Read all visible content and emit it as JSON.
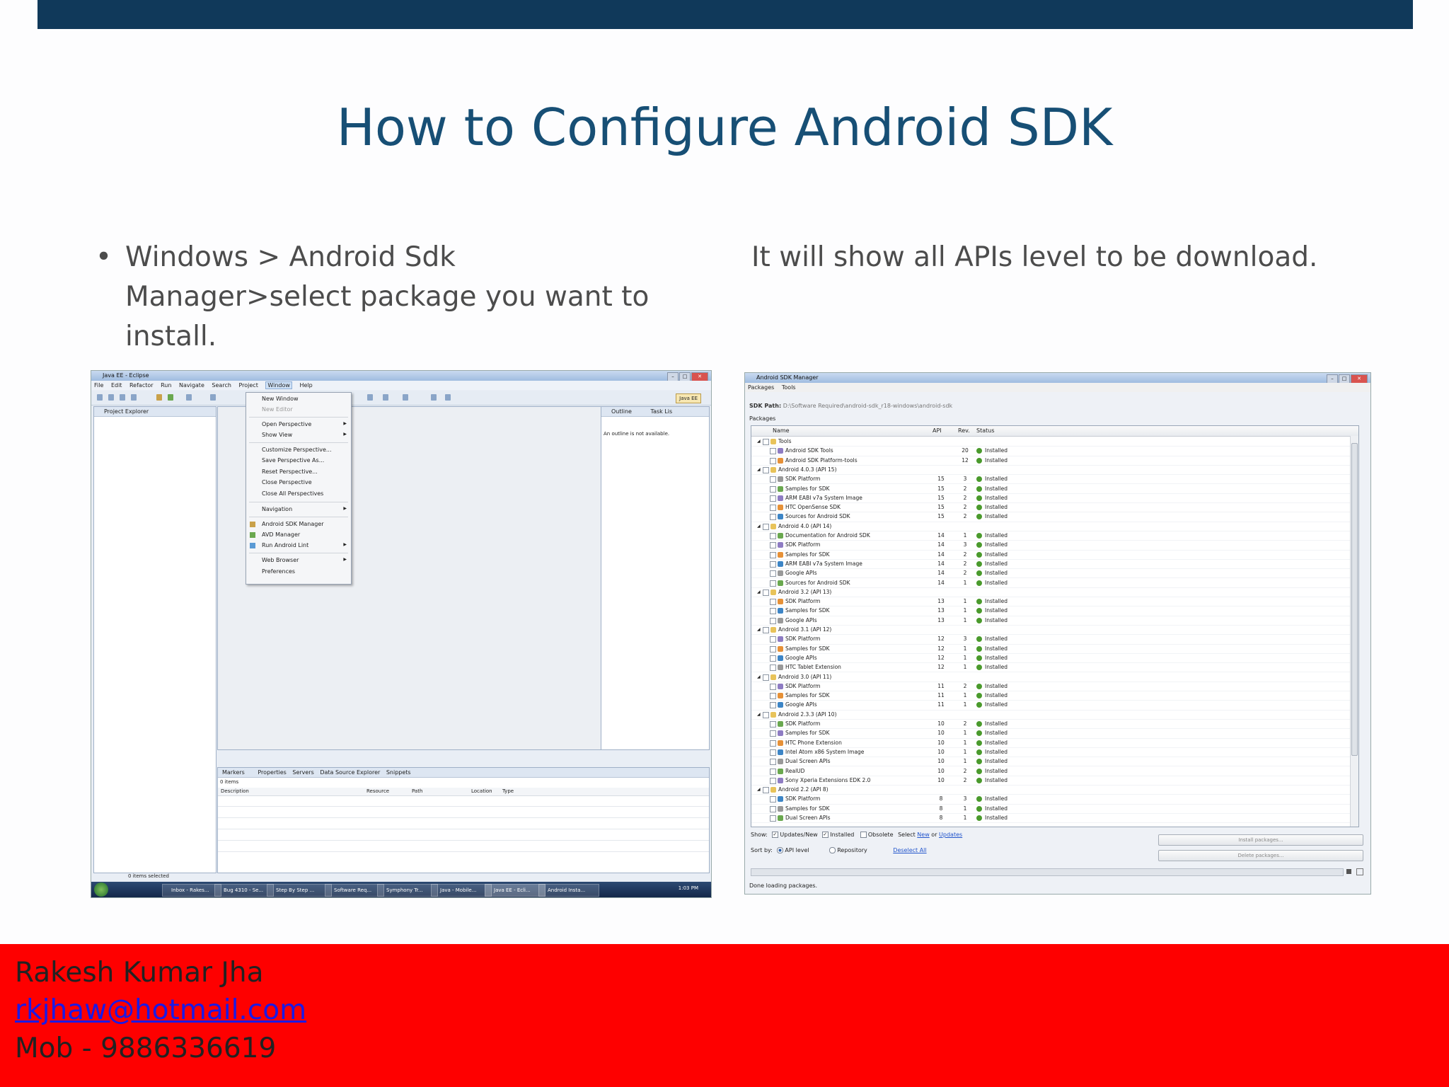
{
  "slide": {
    "title": "How to Configure Android SDK",
    "bullet_left": "Windows > Android Sdk Manager>select package you want to install.",
    "bullet_right": "It will show all APIs level to be download."
  },
  "footer": {
    "name": "Rakesh Kumar Jha",
    "email": "rkjhaw@hotmail.com",
    "phone": "Mob - 9886336619"
  },
  "colors": {
    "top_bar": "#10395a",
    "title": "#174f75",
    "footer_bg": "#fe0000",
    "link": "#1a1ae6"
  },
  "eclipse": {
    "window_title": "Java EE - Eclipse",
    "menus": [
      "File",
      "Edit",
      "Refactor",
      "Run",
      "Navigate",
      "Search",
      "Project",
      "Window",
      "Help"
    ],
    "active_menu": "Window",
    "perspective": "Java EE",
    "project_explorer_title": "Project Explorer",
    "outline_title": "Outline",
    "task_list_title": "Task Lis",
    "outline_message": "An outline is not available.",
    "window_menu_items": [
      "New Window",
      "New Editor",
      "Open Perspective",
      "Show View",
      "Customize Perspective...",
      "Save Perspective As...",
      "Reset Perspective...",
      "Close Perspective",
      "Close All Perspectives",
      "Navigation",
      "Android SDK Manager",
      "AVD Manager",
      "Run Android Lint",
      "Web Browser",
      "Preferences"
    ],
    "bottom_tabs": [
      "Markers",
      "Properties",
      "Servers",
      "Data Source Explorer",
      "Snippets"
    ],
    "items_count": "0 items",
    "columns": [
      "Description",
      "Resource",
      "Path",
      "Location",
      "Type"
    ],
    "status": "0 items selected",
    "taskbar_items": [
      "Inbox - Rakes...",
      "Bug 4310 - Se...",
      "Step By Step ...",
      "Software Req...",
      "Symphony Tr...",
      "Java - Mobile...",
      "Java EE - Ecli...",
      "Android Insta..."
    ],
    "clock": "1:03 PM"
  },
  "sdk_manager": {
    "window_title": "Android SDK Manager",
    "menus": [
      "Packages",
      "Tools"
    ],
    "sdk_path_label": "SDK Path:",
    "sdk_path": "D:\\Software Required\\android-sdk_r18-windows\\android-sdk",
    "packages_label": "Packages",
    "columns": {
      "name": "Name",
      "api": "API",
      "rev": "Rev.",
      "status": "Status"
    },
    "rows": [
      {
        "name": "Tools",
        "api": "",
        "rev": "",
        "status": "",
        "group": true
      },
      {
        "name": "Android SDK Tools",
        "api": "",
        "rev": "20",
        "status": "Installed"
      },
      {
        "name": "Android SDK Platform-tools",
        "api": "",
        "rev": "12",
        "status": "Installed"
      },
      {
        "name": "Android 4.0.3 (API 15)",
        "api": "",
        "rev": "",
        "status": "",
        "group": true
      },
      {
        "name": "SDK Platform",
        "api": "15",
        "rev": "3",
        "status": "Installed"
      },
      {
        "name": "Samples for SDK",
        "api": "15",
        "rev": "2",
        "status": "Installed"
      },
      {
        "name": "ARM EABI v7a System Image",
        "api": "15",
        "rev": "2",
        "status": "Installed"
      },
      {
        "name": "HTC OpenSense SDK",
        "api": "15",
        "rev": "2",
        "status": "Installed"
      },
      {
        "name": "Sources for Android SDK",
        "api": "15",
        "rev": "2",
        "status": "Installed"
      },
      {
        "name": "Android 4.0 (API 14)",
        "api": "",
        "rev": "",
        "status": "",
        "group": true
      },
      {
        "name": "Documentation for Android SDK",
        "api": "14",
        "rev": "1",
        "status": "Installed"
      },
      {
        "name": "SDK Platform",
        "api": "14",
        "rev": "3",
        "status": "Installed"
      },
      {
        "name": "Samples for SDK",
        "api": "14",
        "rev": "2",
        "status": "Installed"
      },
      {
        "name": "ARM EABI v7a System Image",
        "api": "14",
        "rev": "2",
        "status": "Installed"
      },
      {
        "name": "Google APIs",
        "api": "14",
        "rev": "2",
        "status": "Installed"
      },
      {
        "name": "Sources for Android SDK",
        "api": "14",
        "rev": "1",
        "status": "Installed"
      },
      {
        "name": "Android 3.2 (API 13)",
        "api": "",
        "rev": "",
        "status": "",
        "group": true
      },
      {
        "name": "SDK Platform",
        "api": "13",
        "rev": "1",
        "status": "Installed"
      },
      {
        "name": "Samples for SDK",
        "api": "13",
        "rev": "1",
        "status": "Installed"
      },
      {
        "name": "Google APIs",
        "api": "13",
        "rev": "1",
        "status": "Installed"
      },
      {
        "name": "Android 3.1 (API 12)",
        "api": "",
        "rev": "",
        "status": "",
        "group": true
      },
      {
        "name": "SDK Platform",
        "api": "12",
        "rev": "3",
        "status": "Installed"
      },
      {
        "name": "Samples for SDK",
        "api": "12",
        "rev": "1",
        "status": "Installed"
      },
      {
        "name": "Google APIs",
        "api": "12",
        "rev": "1",
        "status": "Installed"
      },
      {
        "name": "HTC Tablet Extension",
        "api": "12",
        "rev": "1",
        "status": "Installed"
      },
      {
        "name": "Android 3.0 (API 11)",
        "api": "",
        "rev": "",
        "status": "",
        "group": true
      },
      {
        "name": "SDK Platform",
        "api": "11",
        "rev": "2",
        "status": "Installed"
      },
      {
        "name": "Samples for SDK",
        "api": "11",
        "rev": "1",
        "status": "Installed"
      },
      {
        "name": "Google APIs",
        "api": "11",
        "rev": "1",
        "status": "Installed"
      },
      {
        "name": "Android 2.3.3 (API 10)",
        "api": "",
        "rev": "",
        "status": "",
        "group": true
      },
      {
        "name": "SDK Platform",
        "api": "10",
        "rev": "2",
        "status": "Installed"
      },
      {
        "name": "Samples for SDK",
        "api": "10",
        "rev": "1",
        "status": "Installed"
      },
      {
        "name": "HTC Phone Extension",
        "api": "10",
        "rev": "1",
        "status": "Installed"
      },
      {
        "name": "Intel Atom x86 System Image",
        "api": "10",
        "rev": "1",
        "status": "Installed"
      },
      {
        "name": "Dual Screen APIs",
        "api": "10",
        "rev": "1",
        "status": "Installed"
      },
      {
        "name": "RealUD",
        "api": "10",
        "rev": "2",
        "status": "Installed"
      },
      {
        "name": "Sony Xperia Extensions EDK 2.0",
        "api": "10",
        "rev": "2",
        "status": "Installed"
      },
      {
        "name": "Android 2.2 (API 8)",
        "api": "",
        "rev": "",
        "status": "",
        "group": true
      },
      {
        "name": "SDK Platform",
        "api": "8",
        "rev": "3",
        "status": "Installed"
      },
      {
        "name": "Samples for SDK",
        "api": "8",
        "rev": "1",
        "status": "Installed"
      },
      {
        "name": "Dual Screen APIs",
        "api": "8",
        "rev": "1",
        "status": "Installed"
      }
    ],
    "show_label": "Show:",
    "updates_new": "Updates/New",
    "installed": "Installed",
    "obsolete": "Obsolete",
    "select_label": "Select",
    "new_link": "New",
    "or_label": "or",
    "updates_link": "Updates",
    "sort_label": "Sort by:",
    "api_level": "API level",
    "repository": "Repository",
    "deselect_all": "Deselect All",
    "install_btn": "Install packages...",
    "delete_btn": "Delete packages...",
    "status": "Done loading packages."
  }
}
